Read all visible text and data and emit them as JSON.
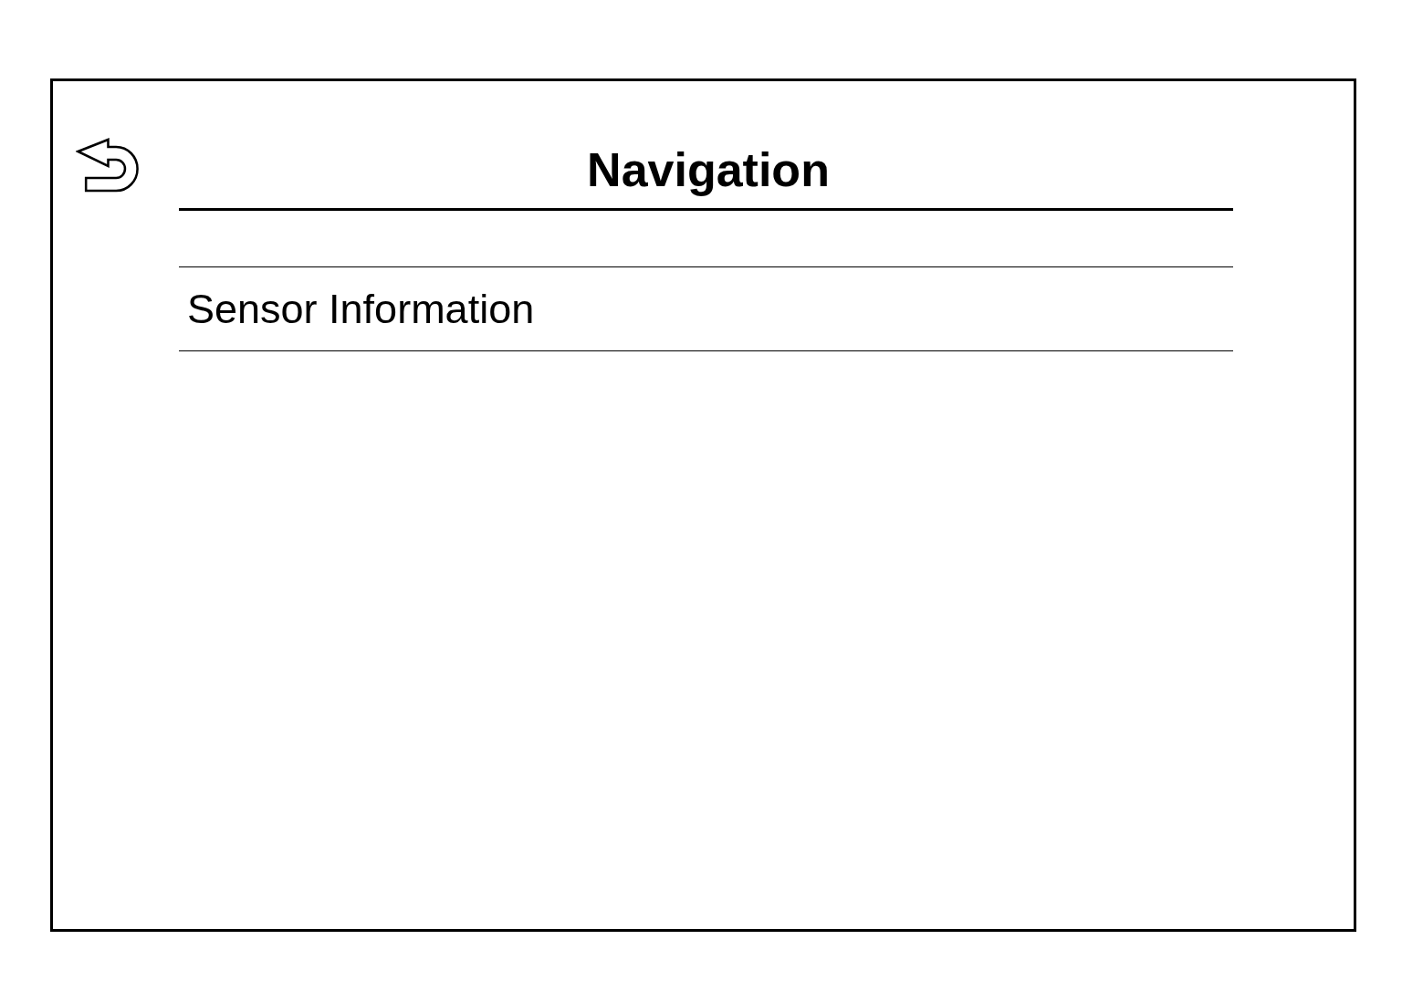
{
  "screen": {
    "title": "Navigation"
  },
  "menu": {
    "items": [
      {
        "label": "Sensor Information"
      }
    ]
  }
}
